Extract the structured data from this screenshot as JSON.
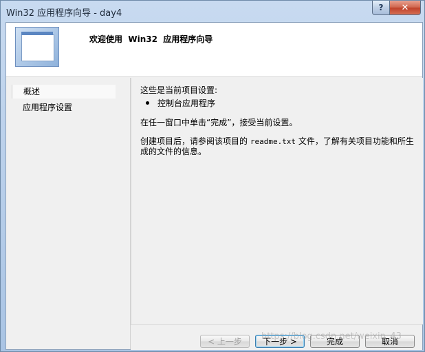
{
  "window": {
    "title": "Win32 应用程序向导 - day4",
    "help_label": "?",
    "close_label": "✕"
  },
  "header": {
    "title": "欢迎使用  Win32  应用程序向导",
    "art_icon": "wizard-window-icon"
  },
  "nav": {
    "items": [
      {
        "label": "概述",
        "active": true
      },
      {
        "label": "应用程序设置",
        "active": false
      }
    ]
  },
  "content": {
    "intro": "这些是当前项目设置:",
    "bullets": [
      "控制台应用程序"
    ],
    "instruction": "在任一窗口中单击“完成”，接受当前设置。",
    "note_prefix": "创建项目后，请参阅该项目的 ",
    "note_file": "readme.txt",
    "note_suffix": " 文件，了解有关项目功能和所生成的文件的信息。"
  },
  "buttons": {
    "prev": "< 上一步",
    "next": "下一步 >",
    "finish": "完成",
    "cancel": "取消"
  },
  "watermark": "https://blog.csdn.net/weixin_43"
}
